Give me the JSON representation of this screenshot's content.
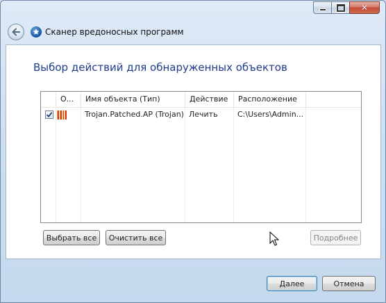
{
  "window": {
    "title": "Сканер вредоносных программ",
    "close_glyph": "✕"
  },
  "page": {
    "heading": "Выбор действий для обнаруженных объектов"
  },
  "table": {
    "columns": [
      "О...",
      "Имя объекта (Тип)",
      "Действие",
      "Расположение"
    ],
    "rows": [
      {
        "checked": true,
        "icon": "threat-icon",
        "name": "Trojan.Patched.AP (Trojan)",
        "action": "Лечить",
        "location": "C:\\Users\\Admin..."
      }
    ]
  },
  "buttons": {
    "select_all": "Выбрать все",
    "clear_all": "Очистить все",
    "details": "Подробнее",
    "next": "Далее",
    "cancel": "Отмена"
  },
  "colors": {
    "heading": "#1e3c8c",
    "threat_icon": "#d53a1c"
  }
}
